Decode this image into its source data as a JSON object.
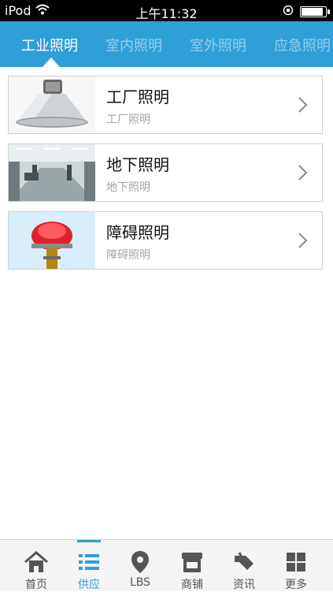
{
  "status_bar": {
    "carrier": "iPod",
    "time": "上午11:32",
    "wifi_icon": "wifi-icon",
    "lock_icon": "rotation-lock-icon",
    "battery_level": 0.95
  },
  "tabs": [
    {
      "label": "工业照明",
      "active": true
    },
    {
      "label": "室内照明",
      "active": false
    },
    {
      "label": "室外照明",
      "active": false
    },
    {
      "label": "应急照明",
      "active": false
    }
  ],
  "items": [
    {
      "title": "工厂照明",
      "subtitle": "工厂照明",
      "image": "factory-lamp-image"
    },
    {
      "title": "地下照明",
      "subtitle": "地下照明",
      "image": "underground-parking-image"
    },
    {
      "title": "障碍照明",
      "subtitle": "障碍照明",
      "image": "obstruction-light-image"
    }
  ],
  "bottom_nav": [
    {
      "label": "首页",
      "icon": "home-icon",
      "active": false
    },
    {
      "label": "供应",
      "icon": "list-icon",
      "active": true
    },
    {
      "label": "LBS",
      "icon": "location-pin-icon",
      "active": false
    },
    {
      "label": "商铺",
      "icon": "store-icon",
      "active": false
    },
    {
      "label": "资讯",
      "icon": "news-icon",
      "active": false
    },
    {
      "label": "更多",
      "icon": "grid-icon",
      "active": false
    }
  ],
  "colors": {
    "accent": "#2f9fd7",
    "tab_inactive": "#8fd0ef",
    "subtitle_gray": "#a6a6a6"
  }
}
